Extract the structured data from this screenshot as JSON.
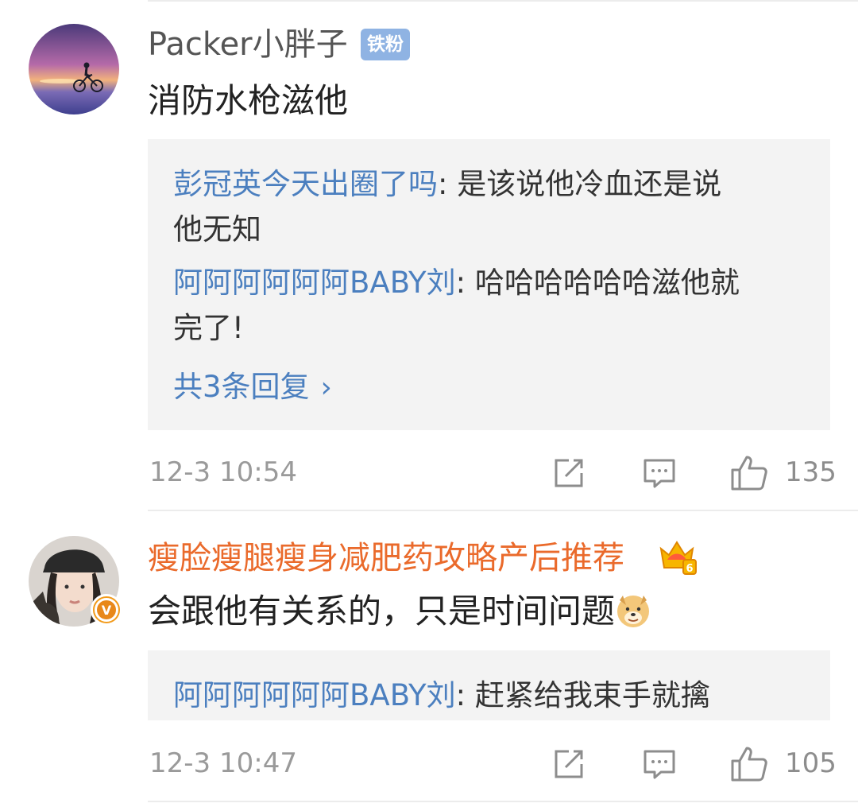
{
  "comments": [
    {
      "username": "Packer小胖子",
      "fan_badge": "铁粉",
      "text": "消防水枪滋他",
      "replies": [
        {
          "name": "彭冠英今天出圈了吗",
          "line1": ": 是该说他冷血还是说",
          "line2": "他无知"
        },
        {
          "name": "阿阿阿阿阿阿BABY刘",
          "line1": ": 哈哈哈哈哈哈滋他就",
          "line2": "完了!"
        }
      ],
      "more_replies": "共3条回复",
      "timestamp": "12-3 10:54",
      "likes": "135"
    },
    {
      "username": "瘦脸瘦腿瘦身减肥药攻略产后推荐",
      "badge_level": "6",
      "verified_mark": "V",
      "text": "会跟他有关系的，只是时间问题",
      "emoji": "doge-emoji",
      "replies": [
        {
          "name": "阿阿阿阿阿阿BABY刘",
          "line1": ": 赶紧给我束手就擒"
        }
      ],
      "timestamp": "12-3 10:47",
      "likes": "105"
    }
  ],
  "icons": {
    "repost": "repost-icon",
    "comment": "comment-icon",
    "like": "thumbs-up-icon",
    "more": "chevron-right-icon"
  },
  "colors": {
    "link_blue": "#4b7fbf",
    "vip_orange": "#ea6a2b",
    "reply_bg": "#f3f3f3",
    "meta_gray": "#9a9a9a"
  }
}
